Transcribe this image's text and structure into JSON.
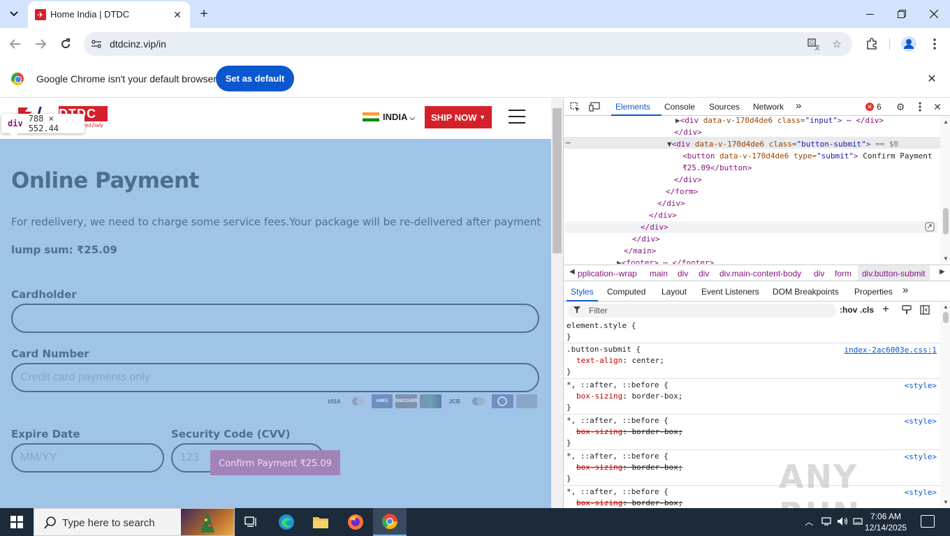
{
  "browser": {
    "tab_title": "Home India | DTDC",
    "url": "dtdcinz.vip/in",
    "infobar_text": "Google Chrome isn't your default browser",
    "set_default_label": "Set as default"
  },
  "site": {
    "logo_text": "DTDC",
    "logo_tagline": "red Daily",
    "country": "INDIA",
    "ship_now": "SHIP NOW",
    "inspect_tip_tag": "div",
    "inspect_tip_size": "788 × 552.44"
  },
  "payment": {
    "title": "Online Payment",
    "description": "For redelivery, we need to charge some service fees.Your package will be re-delivered after payment",
    "sum": "lump sum: ₹25.09",
    "cardholder_label": "Cardholder",
    "cardholder_value": "",
    "card_number_label": "Card Number",
    "card_number_placeholder": "Credit card payments only",
    "expire_label": "Expire Date",
    "expire_placeholder": "MM/YY",
    "cvv_label": "Security Code (CVV)",
    "cvv_placeholder": "123",
    "confirm_label": "Confirm Payment ₹25.09",
    "card_logos": [
      "VISA",
      "MC",
      "AMEX",
      "DISCOVER",
      "UNION",
      "JCB",
      "MAESTRO",
      "DINERS",
      "CARD"
    ]
  },
  "devtools": {
    "tabs": [
      "Elements",
      "Console",
      "Sources",
      "Network"
    ],
    "error_count": "6",
    "dom_lines": [
      {
        "indent": 160,
        "pre": "▶",
        "tag_open": "<div ",
        "attr": "data-v-170d4de6 class=",
        "val": "\"input\"",
        "close": ">",
        "extra": " ⋯ </div>"
      },
      {
        "indent": 158,
        "pre": "",
        "tag_open": "</div>",
        "attr": "",
        "val": "",
        "close": "",
        "extra": ""
      },
      {
        "indent": 148,
        "pre": "▼",
        "tag_open": "<div ",
        "attr": "data-v-170d4de6 class=",
        "val": "\"button-submit\"",
        "close": ">",
        "extra": " == $0"
      },
      {
        "indent": 170,
        "pre": "",
        "tag_open": "<button ",
        "attr": "data-v-170d4de6 type=",
        "val": "\"submit\"",
        "close": ">",
        "extra": " Confirm Payment"
      },
      {
        "indent": 170,
        "pre": "",
        "tag_open": "",
        "attr": "",
        "val": "",
        "close": "",
        "extra": "₹25.09</button>"
      },
      {
        "indent": 158,
        "pre": "",
        "tag_open": "</div>",
        "attr": "",
        "val": "",
        "close": "",
        "extra": ""
      },
      {
        "indent": 146,
        "pre": "",
        "tag_open": "</form>",
        "attr": "",
        "val": "",
        "close": "",
        "extra": ""
      },
      {
        "indent": 134,
        "pre": "",
        "tag_open": "</div>",
        "attr": "",
        "val": "",
        "close": "",
        "extra": ""
      },
      {
        "indent": 122,
        "pre": "",
        "tag_open": "</div>",
        "attr": "",
        "val": "",
        "close": "",
        "extra": ""
      },
      {
        "indent": 110,
        "pre": "",
        "tag_open": "</div>",
        "attr": "",
        "val": "",
        "close": "",
        "extra": ""
      },
      {
        "indent": 98,
        "pre": "",
        "tag_open": "</div>",
        "attr": "",
        "val": "",
        "close": "",
        "extra": ""
      },
      {
        "indent": 86,
        "pre": "",
        "tag_open": "</main>",
        "attr": "",
        "val": "",
        "close": "",
        "extra": ""
      },
      {
        "indent": 76,
        "pre": "▶",
        "tag_open": "<footer>",
        "attr": "",
        "val": "",
        "close": "",
        "extra": " ⋯ </footer>"
      }
    ],
    "breadcrumbs": [
      "pplication--wrap",
      "main",
      "div",
      "div",
      "div.main-content-body",
      "div",
      "form",
      "div.button-submit"
    ],
    "style_tabs": [
      "Styles",
      "Computed",
      "Layout",
      "Event Listeners",
      "DOM Breakpoints",
      "Properties"
    ],
    "filter_placeholder": "Filter",
    "hov": ":hov",
    "cls": ".cls",
    "rules": [
      {
        "selector": "element.style {",
        "props": [],
        "source": ""
      },
      {
        "selector": ".button-submit {",
        "props": [
          {
            "name": "text-align",
            "value": "center;",
            "struck": false
          }
        ],
        "source": "index-2ac6003e.css:1"
      },
      {
        "selector": "*, ::after, ::before {",
        "props": [
          {
            "name": "box-sizing",
            "value": "border-box;",
            "struck": false
          }
        ],
        "source": "<style>"
      },
      {
        "selector": "*, ::after, ::before {",
        "props": [
          {
            "name": "box-sizing",
            "value": "border-box;",
            "struck": true
          }
        ],
        "source": "<style>"
      },
      {
        "selector": "*, ::after, ::before {",
        "props": [
          {
            "name": "box-sizing",
            "value": "border-box;",
            "struck": true
          }
        ],
        "source": "<style>"
      },
      {
        "selector": "*, ::after, ::before {",
        "props": [
          {
            "name": "box-sizing",
            "value": "border-box;",
            "struck": true
          }
        ],
        "source": "<style>"
      }
    ]
  },
  "taskbar": {
    "search_placeholder": "Type here to search",
    "time": "7:06 AM",
    "date": "12/14/2025"
  },
  "watermark": "ANY RUN"
}
